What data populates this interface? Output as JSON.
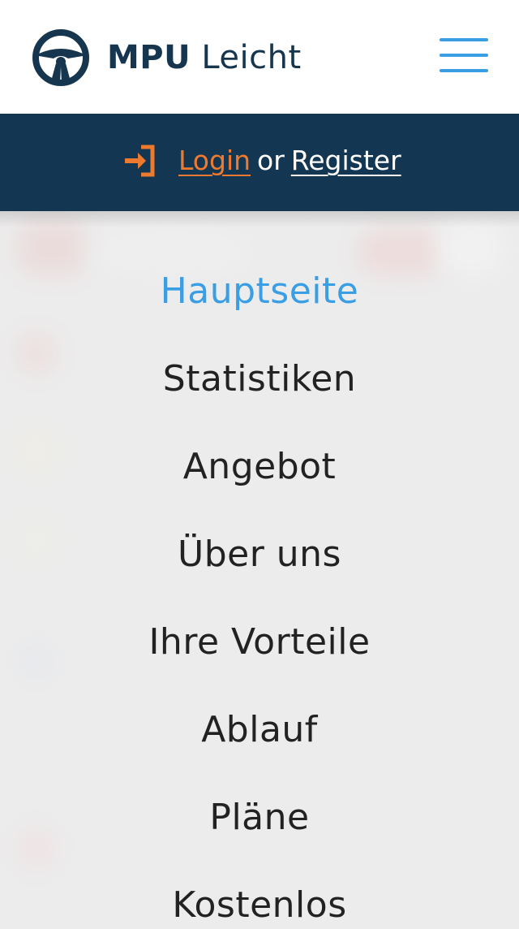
{
  "brand": {
    "name_bold": "MPU",
    "name_light": "Leicht",
    "logo_icon": "steering-wheel-icon",
    "menu_icon": "hamburger-menu-icon"
  },
  "auth": {
    "icon": "login-arrow-icon",
    "login_label": "Login",
    "or_label": "or",
    "register_label": "Register"
  },
  "menu": {
    "items": [
      {
        "label": "Hauptseite",
        "active": true
      },
      {
        "label": "Statistiken",
        "active": false
      },
      {
        "label": "Angebot",
        "active": false
      },
      {
        "label": "Über uns",
        "active": false
      },
      {
        "label": "Ihre Vorteile",
        "active": false
      },
      {
        "label": "Ablauf",
        "active": false
      },
      {
        "label": "Pläne",
        "active": false
      },
      {
        "label": "Kostenlos",
        "active": false
      }
    ]
  },
  "colors": {
    "brand_dark": "#16364f",
    "login_bar": "#133752",
    "accent_blue": "#3a9ee4",
    "accent_orange": "#ee7a2f"
  }
}
